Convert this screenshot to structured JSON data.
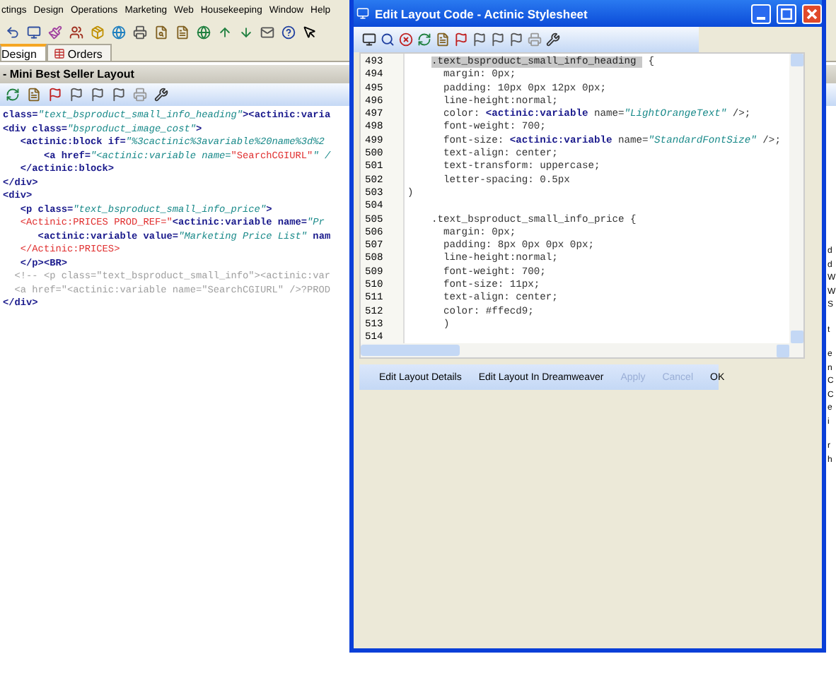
{
  "app": {
    "menu": [
      "ctings",
      "Design",
      "Operations",
      "Marketing",
      "Web",
      "Housekeeping",
      "Window",
      "Help"
    ],
    "tabs": [
      {
        "label": "Design",
        "selected": true
      },
      {
        "label": "Orders",
        "selected": false
      }
    ],
    "panel_title": "- Mini Best Seller Layout",
    "code": [
      [
        {
          "kind": "tag",
          "text": "class="
        },
        {
          "kind": "str",
          "text": "\"text_bsproduct_small_info_heading\""
        },
        {
          "kind": "tag",
          "text": "><actinic:varia"
        }
      ],
      [
        {
          "kind": "tag",
          "text": "<div class="
        },
        {
          "kind": "str",
          "text": "\"bsproduct_image_cost\""
        },
        {
          "kind": "tag",
          "text": ">"
        }
      ],
      [
        {
          "kind": "tag",
          "text": "   <actinic:block if="
        },
        {
          "kind": "str",
          "text": "\"%3cactinic%3avariable%20name%3d%2"
        }
      ],
      [
        {
          "kind": "tag",
          "text": "       <a href="
        },
        {
          "kind": "str",
          "text": "\"<actinic:variable name="
        },
        {
          "kind": "red",
          "text": "\"SearchCGIURL\""
        },
        {
          "kind": "str",
          "text": "\" /"
        }
      ],
      [
        {
          "kind": "tag",
          "text": "   </actinic:block>"
        }
      ],
      [
        {
          "kind": "tag",
          "text": "</div>"
        }
      ],
      [
        {
          "kind": "tag",
          "text": "<div>"
        }
      ],
      [
        {
          "kind": "tag",
          "text": "   <p class="
        },
        {
          "kind": "str",
          "text": "\"text_bsproduct_small_info_price\""
        },
        {
          "kind": "tag",
          "text": ">"
        }
      ],
      [
        {
          "kind": "red",
          "text": "   <Actinic:PRICES PROD_REF=\""
        },
        {
          "kind": "tag",
          "text": "<actinic:variable name="
        },
        {
          "kind": "str",
          "text": "\"Pr"
        }
      ],
      [
        {
          "kind": "tag",
          "text": "      <actinic:variable value="
        },
        {
          "kind": "str",
          "text": "\"Marketing Price List\""
        },
        {
          "kind": "tag",
          "text": " nam"
        }
      ],
      [
        {
          "kind": "red",
          "text": "   </Actinic:PRICES>"
        }
      ],
      [
        {
          "kind": "tag",
          "text": "   </p><BR>"
        }
      ],
      [
        {
          "kind": "comment",
          "text": "  <!-- <p class=\"text_bsproduct_small_info\"><actinic:var"
        }
      ],
      [
        {
          "kind": "comment",
          "text": "  <a href=\"<actinic:variable name=\"SearchCGIURL\" />?PROD"
        }
      ],
      [
        {
          "kind": "tag",
          "text": "</div>"
        }
      ]
    ],
    "right_fragments": [
      [
        "d",
        "d",
        "W",
        "W",
        "S"
      ],
      [
        "t"
      ],
      [
        "e",
        "n",
        "C",
        "C",
        "e",
        "i"
      ],
      [
        "r",
        "h"
      ]
    ]
  },
  "dialog": {
    "title": "Edit Layout Code - Actinic Stylesheet",
    "lines": [
      {
        "number": "493",
        "segments": [
          {
            "kind": "selected",
            "text": ".text_bsproduct_small_info_heading "
          },
          {
            "kind": "plain",
            "text": " {"
          }
        ]
      },
      {
        "number": "494",
        "segments": [
          {
            "kind": "plain",
            "text": "      margin: 0px;"
          }
        ]
      },
      {
        "number": "495",
        "segments": [
          {
            "kind": "plain",
            "text": "      padding: 10px 0px 12px 0px;"
          }
        ]
      },
      {
        "number": "496",
        "segments": [
          {
            "kind": "plain",
            "text": "      line-height:normal;"
          }
        ]
      },
      {
        "number": "497",
        "segments": [
          {
            "kind": "plain",
            "text": "      color: "
          },
          {
            "kind": "tag",
            "text": "<actinic:variable"
          },
          {
            "kind": "plain",
            "text": " name="
          },
          {
            "kind": "str",
            "text": "\"LightOrangeText\""
          },
          {
            "kind": "plain",
            "text": " />;"
          }
        ]
      },
      {
        "number": "498",
        "segments": [
          {
            "kind": "plain",
            "text": "      font-weight: 700;"
          }
        ]
      },
      {
        "number": "499",
        "segments": [
          {
            "kind": "plain",
            "text": "      font-size: "
          },
          {
            "kind": "tag",
            "text": "<actinic:variable"
          },
          {
            "kind": "plain",
            "text": " name="
          },
          {
            "kind": "str",
            "text": "\"StandardFontSize\""
          },
          {
            "kind": "plain",
            "text": " />;"
          }
        ]
      },
      {
        "number": "500",
        "segments": [
          {
            "kind": "plain",
            "text": "      text-align: center;"
          }
        ]
      },
      {
        "number": "501",
        "segments": [
          {
            "kind": "plain",
            "text": "      text-transform: uppercase;"
          }
        ]
      },
      {
        "number": "502",
        "segments": [
          {
            "kind": "plain",
            "text": "      letter-spacing: 0.5px"
          }
        ]
      },
      {
        "number": "503",
        "segments": [
          {
            "kind": "plain",
            "text": ")"
          }
        ]
      },
      {
        "number": "504"
      },
      {
        "number": "505",
        "segments": [
          {
            "kind": "plain",
            "text": "    .text_bsproduct_small_info_price {"
          }
        ]
      },
      {
        "number": "506",
        "segments": [
          {
            "kind": "plain",
            "text": "      margin: 0px;"
          }
        ]
      },
      {
        "number": "507",
        "segments": [
          {
            "kind": "plain",
            "text": "      padding: 8px 0px 0px 0px;"
          }
        ]
      },
      {
        "number": "508",
        "segments": [
          {
            "kind": "plain",
            "text": "      line-height:normal;"
          }
        ]
      },
      {
        "number": "509",
        "segments": [
          {
            "kind": "plain",
            "text": "      font-weight: 700;"
          }
        ]
      },
      {
        "number": "510",
        "segments": [
          {
            "kind": "plain",
            "text": "      font-size: 11px;"
          }
        ]
      },
      {
        "number": "511",
        "segments": [
          {
            "kind": "plain",
            "text": "      text-align: center;"
          }
        ]
      },
      {
        "number": "512",
        "segments": [
          {
            "kind": "plain",
            "text": "      color: #ffecd9;"
          }
        ]
      },
      {
        "number": "513",
        "segments": [
          {
            "kind": "plain",
            "text": "      )"
          }
        ]
      },
      {
        "number": "514"
      }
    ],
    "buttons": [
      {
        "label": "Edit Layout Details",
        "disabled": false
      },
      {
        "label": "Edit Layout In Dreamweaver",
        "disabled": false
      },
      {
        "label": "Apply",
        "disabled": true
      },
      {
        "label": "Cancel",
        "disabled": true
      },
      {
        "label": "OK",
        "disabled": false
      }
    ]
  }
}
